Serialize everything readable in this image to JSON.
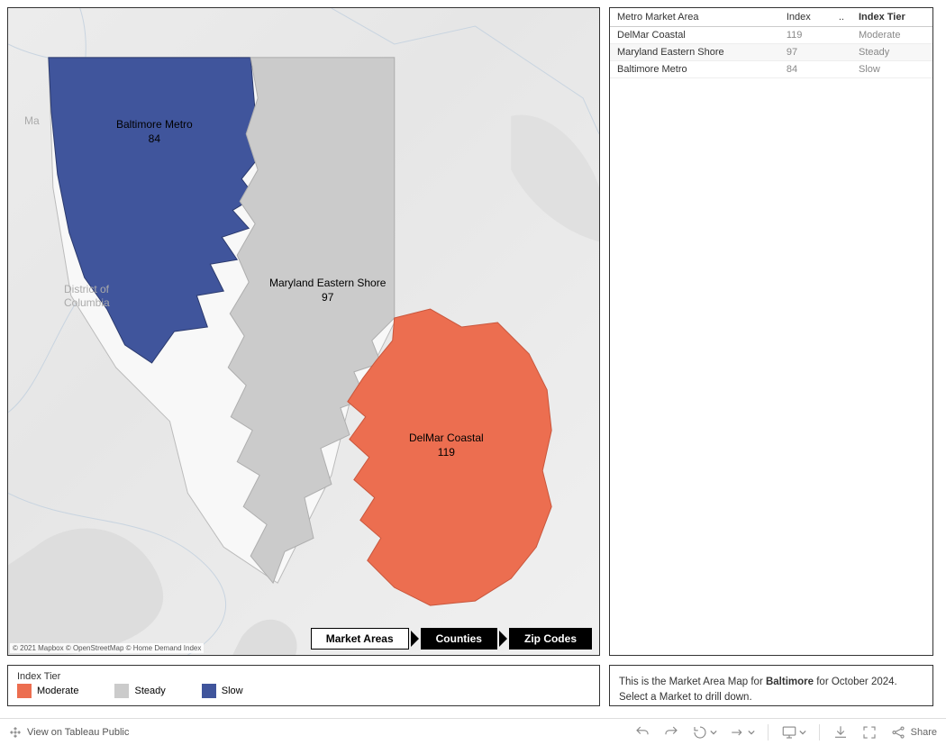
{
  "colors": {
    "moderate": "#ec6e50",
    "steady": "#cbcbcb",
    "slow": "#40559c"
  },
  "legend": {
    "title": "Index Tier",
    "items": [
      {
        "label": "Moderate",
        "colorKey": "moderate"
      },
      {
        "label": "Steady",
        "colorKey": "steady"
      },
      {
        "label": "Slow",
        "colorKey": "slow"
      }
    ]
  },
  "nav": {
    "items": [
      {
        "label": "Market Areas",
        "active": true
      },
      {
        "label": "Counties",
        "active": false
      },
      {
        "label": "Zip Codes",
        "active": false
      }
    ]
  },
  "bgLabels": {
    "maryland": "Ma",
    "dc1": "District of",
    "dc2": "Columbia"
  },
  "regions": {
    "baltimore": {
      "name": "Baltimore Metro",
      "value": "84"
    },
    "eastern": {
      "name": "Maryland Eastern Shore",
      "value": "97"
    },
    "delmar": {
      "name": "DelMar Coastal",
      "value": "119"
    }
  },
  "attribution": "© 2021 Mapbox © OpenStreetMap © Home Demand Index",
  "table": {
    "headers": {
      "c0": "Metro Market Area",
      "c1": "Index",
      "c2": "..",
      "c3": "Index Tier"
    },
    "rows": [
      {
        "area": "DelMar Coastal",
        "index": "119",
        "tier": "Moderate"
      },
      {
        "area": "Maryland Eastern Shore",
        "index": "97",
        "tier": "Steady"
      },
      {
        "area": "Baltimore Metro",
        "index": "84",
        "tier": "Slow"
      }
    ]
  },
  "caption": {
    "prefix": "This is the Market Area Map for ",
    "bold": "Baltimore",
    "suffix": " for October 2024.",
    "line2": "Select a Market to drill down."
  },
  "toolbar": {
    "view": "View on Tableau Public",
    "share": "Share"
  }
}
